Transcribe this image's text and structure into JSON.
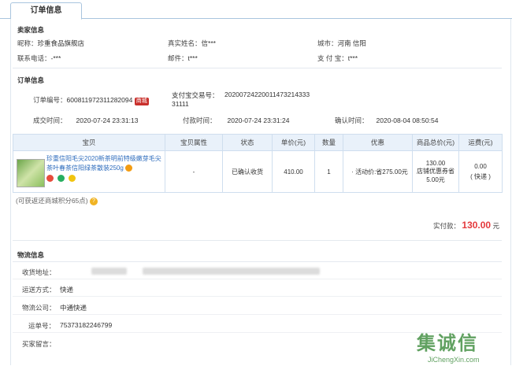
{
  "tab": {
    "label": "订单信息"
  },
  "seller": {
    "title": "卖家信息",
    "nick_label": "昵称：",
    "nick": "珍重食品旗舰店",
    "realname_label": "真实姓名：",
    "realname": "信***",
    "city_label": "城市：",
    "city": "河南 信阳",
    "phone_label": "联系电话：",
    "phone": "-***",
    "email_label": "邮件：",
    "email": "t***",
    "alipay_label": "支 付 宝：",
    "alipay": "t***"
  },
  "order": {
    "title": "订单信息",
    "no_label": "订单编号：",
    "no": "600811972311282094",
    "no_badge": "商城",
    "trade_label": "支付宝交易号：",
    "trade_no_line1": "20200724220011473214333",
    "trade_no_line2": "31111",
    "created_label": "成交时间：",
    "created": "2020-07-24 23:31:13",
    "paid_label": "付款时间：",
    "paid": "2020-07-24 23:31:24",
    "confirm_label": "确认时间：",
    "confirm": "2020-08-04 08:50:54"
  },
  "goods_table": {
    "headers": [
      "宝贝",
      "宝贝属性",
      "状态",
      "单价(元)",
      "数量",
      "优惠",
      "商品总价(元)",
      "运费(元)"
    ],
    "row": {
      "title": "珍重信阳毛尖2020新茶明前特级嫩芽毛尖茶叶春茶信阳绿茶散装250g",
      "attr": "-",
      "status": "已确认收货",
      "price": "410.00",
      "qty": "1",
      "promo": "· 活动价:省275.00元",
      "total_line1": "130.00",
      "total_line2": "店铺优惠券省",
      "total_line3": "5.00元",
      "shipping_line1": "0.00",
      "shipping_line2": "( 快递 )"
    }
  },
  "points_note": "(可获返还商城积分65点)",
  "payment": {
    "label": "实付款：",
    "amount": "130.00",
    "unit": "元"
  },
  "logistics": {
    "title": "物流信息",
    "address_label": "收货地址：",
    "method_label": "运送方式：",
    "method": "快递",
    "company_label": "物流公司：",
    "company": "中通快递",
    "waybill_label": "运单号：",
    "waybill": "75373182246799",
    "message_label": "买家留言：",
    "message": ""
  },
  "watermark": {
    "brand": "集诚信",
    "site": "JiChengXin.com"
  }
}
